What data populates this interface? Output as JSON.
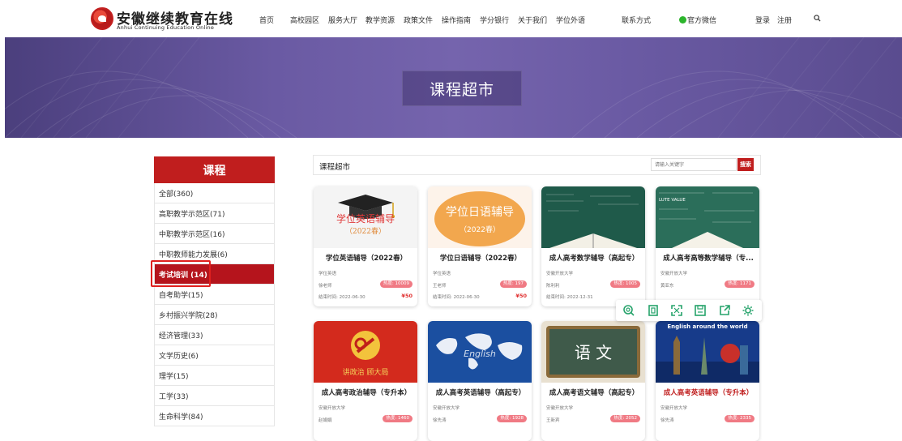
{
  "header": {
    "logo_cn": "安徽继续教育在线",
    "logo_en": "Anhui Continuing Education Online",
    "nav": [
      "首页",
      "高校园区",
      "服务大厅",
      "教学资源",
      "政策文件",
      "操作指南",
      "学分银行",
      "关于我们",
      "学位外语"
    ],
    "contact": "联系方式",
    "wechat": "官方微信",
    "login": "登录",
    "register": "注册"
  },
  "banner": {
    "title": "课程超市"
  },
  "sidebar": {
    "title": "课程",
    "items": [
      {
        "label": "全部(360)"
      },
      {
        "label": "高职教学示范区(71)"
      },
      {
        "label": "中职教学示范区(16)"
      },
      {
        "label": "中职教师能力发展(6)"
      },
      {
        "label": "考试培训 (14)",
        "active": true
      },
      {
        "label": "自考助学(15)"
      },
      {
        "label": "乡村振兴学院(28)"
      },
      {
        "label": "经济管理(33)"
      },
      {
        "label": "文学历史(6)"
      },
      {
        "label": "理学(15)"
      },
      {
        "label": "工学(33)"
      },
      {
        "label": "生命科学(84)"
      }
    ]
  },
  "main": {
    "title": "课程超市",
    "search_placeholder": "请输入关键字",
    "search_button": "搜索"
  },
  "cards": [
    {
      "title": "学位英语辅导（2022春）",
      "category": "学位英语",
      "teacher": "徐老师",
      "hot": "热度: 10009",
      "end": "结束时间: 2022-06-30",
      "price": "¥50",
      "img_text": "学位英语辅导",
      "img_sub": "（2022春）"
    },
    {
      "title": "学位日语辅导（2022春）",
      "category": "学位英语",
      "teacher": "王老师",
      "hot": "热度: 197",
      "end": "结束时间: 2022-06-30",
      "price": "¥50",
      "img_text": "学位日语辅导",
      "img_sub": "（2022春）"
    },
    {
      "title": "成人高考数学辅导（高起专）",
      "category": "安徽开放大学",
      "teacher": "陈利利",
      "hot": "热度: 1005",
      "end": "结束时间: 2022-12-31",
      "price": "",
      "img_text": "",
      "img_sub": ""
    },
    {
      "title": "成人高考高等数学辅导（专...",
      "category": "安徽开放大学",
      "teacher": "黄亚东",
      "hot": "热度: 1171",
      "end": "",
      "price": "",
      "img_text": "LUTE VALUE",
      "img_sub": ""
    },
    {
      "title": "成人高考政治辅导（专升本）",
      "category": "安徽开放大学",
      "teacher": "赵娟娟",
      "hot": "热度: 1460",
      "end": "",
      "price": "",
      "img_text": "讲政治 顾大局",
      "img_sub": ""
    },
    {
      "title": "成人高考英语辅导（高起专）",
      "category": "安徽开放大学",
      "teacher": "徐先涛",
      "hot": "热度: 1928",
      "end": "",
      "price": "",
      "img_text": "English",
      "img_sub": ""
    },
    {
      "title": "成人高考语文辅导（高起专）",
      "category": "安徽开放大学",
      "teacher": "王新宾",
      "hot": "热度: 2052",
      "end": "",
      "price": "",
      "img_text": "语 文",
      "img_sub": ""
    },
    {
      "title": "成人高考英语辅导（专升本）",
      "category": "安徽开放大学",
      "teacher": "徐先涛",
      "hot": "热度: 2335",
      "end": "",
      "price": "",
      "img_text": "English around the world",
      "img_sub": ""
    }
  ],
  "colors": {
    "brand_red": "#c01e1e",
    "banner_purple": "#6a5aa3",
    "hot_pink": "#f07a84",
    "toolbar_green": "#26a36b"
  }
}
